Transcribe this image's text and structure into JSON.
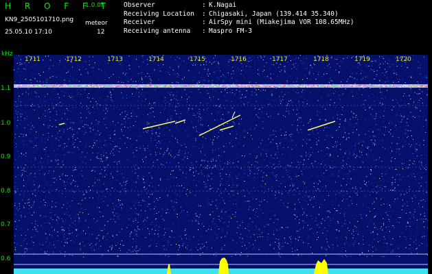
{
  "header": {
    "brand": "H R O F F T",
    "version": "1.0.0f",
    "filename": "KN9_2505101710.png",
    "meteor_label": "meteor",
    "timestamp": "25.05.10 17:10",
    "meteor_count": "12",
    "info": [
      {
        "key": "Observer",
        "value": "K.Nagai"
      },
      {
        "key": "Receiving Location",
        "value": "Chigasaki, Japan (139.414 35.340)"
      },
      {
        "key": "Receiver",
        "value": "AirSpy mini (Miakejima VOR 108.65MHz)"
      },
      {
        "key": "Receiving antenna",
        "value": "Maspro FM-3"
      }
    ]
  },
  "axis": {
    "unit": "kHz",
    "x_ticks": [
      "1711",
      "1712",
      "1713",
      "1714",
      "1715",
      "1716",
      "1717",
      "1718",
      "1719",
      "1720"
    ],
    "y_ticks": [
      "1.1",
      "1.0",
      "0.9",
      "0.8",
      "0.7",
      "0.6"
    ]
  },
  "colors": {
    "background": "#05106a",
    "brand": "#18e018",
    "tick_x": "#e8e830",
    "carrier": "#e8e8ff",
    "meteor": "#ffff60",
    "activity": "#ffff00",
    "baseline": "#40e0f0"
  }
}
